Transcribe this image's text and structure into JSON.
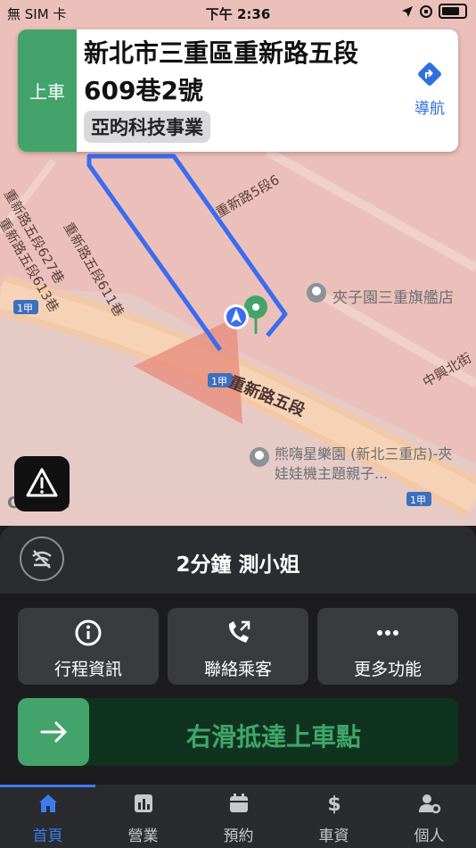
{
  "status_bar": {
    "carrier": "無 SIM 卡",
    "time": "下午 2:36"
  },
  "pickup_card": {
    "side_label": "上車",
    "address": "新北市三重區重新路五段609巷2號",
    "place_tag": "亞昀科技事業",
    "nav_label": "導航"
  },
  "map": {
    "labels": {
      "road_main": "重新路五段",
      "road_5_6": "重新路5段6",
      "lane_627": "重新路五段627巷",
      "lane_611": "重新路五段611巷",
      "lane_613": "重新路五段613巷",
      "zhongxing": "中興北街",
      "store": "夾子園三重旗艦店",
      "park": "熊嗨星樂園 (新北三重店)-夾娃娃機主題親子...",
      "route_1": "1甲",
      "google": "Google"
    },
    "colors": {
      "route": "#3b6cf0",
      "overlay": "#e9c3bd",
      "road": "#f2c9a6"
    }
  },
  "panel": {
    "eta_text": "2分鐘  測小姐",
    "actions": [
      {
        "label": "行程資訊",
        "icon": "info-icon"
      },
      {
        "label": "聯絡乘客",
        "icon": "phone-icon"
      },
      {
        "label": "更多功能",
        "icon": "more-icon"
      }
    ],
    "slide_text": "右滑抵達上車點"
  },
  "tabs": [
    {
      "label": "首頁",
      "icon": "home-icon",
      "active": true
    },
    {
      "label": "營業",
      "icon": "chart-icon",
      "active": false
    },
    {
      "label": "預約",
      "icon": "calendar-icon",
      "active": false
    },
    {
      "label": "車資",
      "icon": "dollar-icon",
      "active": false
    },
    {
      "label": "個人",
      "icon": "user-settings-icon",
      "active": false
    }
  ]
}
